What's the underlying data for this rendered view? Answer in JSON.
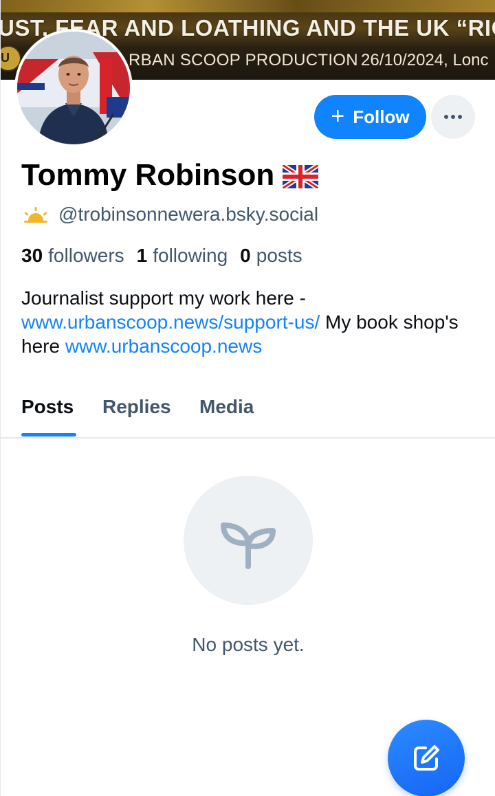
{
  "banner": {
    "title": "UST, FEAR AND LOATHING AND THE UK “RIOT",
    "production": "RBAN SCOOP PRODUCTION",
    "date": "26/10/2024, Lonc",
    "logo_letter": "U"
  },
  "profile": {
    "display_name": "Tommy Robinson",
    "name_flag_icon": "uk-flag-icon",
    "handle_icon": "sunrise-icon",
    "handle": "@trobinsonnewera.bsky.social",
    "stats": {
      "followers_count": "30",
      "followers_label": "followers",
      "following_count": "1",
      "following_label": "following",
      "posts_count": "0",
      "posts_label": "posts"
    },
    "bio": {
      "text_1": "Journalist support my work here - ",
      "link_1": "www.urbanscoop.news/support-us/",
      "text_2": " My book shop's here ",
      "link_2": "www.urbanscoop.news"
    }
  },
  "actions": {
    "follow_label": "Follow",
    "follow_icon": "plus-icon",
    "more_icon": "ellipsis-icon"
  },
  "tabs": [
    {
      "label": "Posts",
      "active": true
    },
    {
      "label": "Replies",
      "active": false
    },
    {
      "label": "Media",
      "active": false
    }
  ],
  "empty_state": {
    "icon": "sprout-icon",
    "message": "No posts yet."
  },
  "fab": {
    "icon": "compose-icon"
  },
  "colors": {
    "accent": "#1083fe",
    "muted_text": "#42576c",
    "empty_circle_bg": "#eef1f4"
  }
}
